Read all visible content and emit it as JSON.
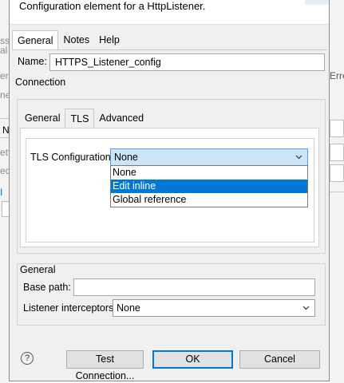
{
  "background": {
    "left_fragments": [
      "ss",
      "al I",
      "er",
      "nes",
      "N",
      "ett",
      "ect",
      "I"
    ],
    "right_fragments": [
      "Erro"
    ]
  },
  "dialog": {
    "header_text": "Configuration element for a HttpListener.",
    "tabs": [
      "General",
      "Notes",
      "Help"
    ],
    "active_tab": "General",
    "name_label": "Name:",
    "name_value": "HTTPS_Listener_config",
    "connection_label": "Connection",
    "inner_tabs": [
      "General",
      "TLS",
      "Advanced"
    ],
    "active_inner_tab": "TLS",
    "tls_label": "TLS Configuration",
    "tls_value": "None",
    "tls_options": [
      "None",
      "Edit inline",
      "Global reference"
    ],
    "tls_highlighted": "Edit inline",
    "general_label": "General",
    "base_path_label": "Base path:",
    "base_path_value": "",
    "interceptors_label": "Listener interceptors",
    "interceptors_value": "None",
    "help_glyph": "?",
    "buttons": {
      "test": "Test Connection...",
      "ok": "OK",
      "cancel": "Cancel"
    }
  },
  "colors": {
    "dialog_bg": "#f0f0f0",
    "accent": "#0078d7",
    "combo_focus_bg": "#cce4f7"
  },
  "icons": {
    "help": "help-circle-icon",
    "dropdown": "chevron-down-icon"
  }
}
